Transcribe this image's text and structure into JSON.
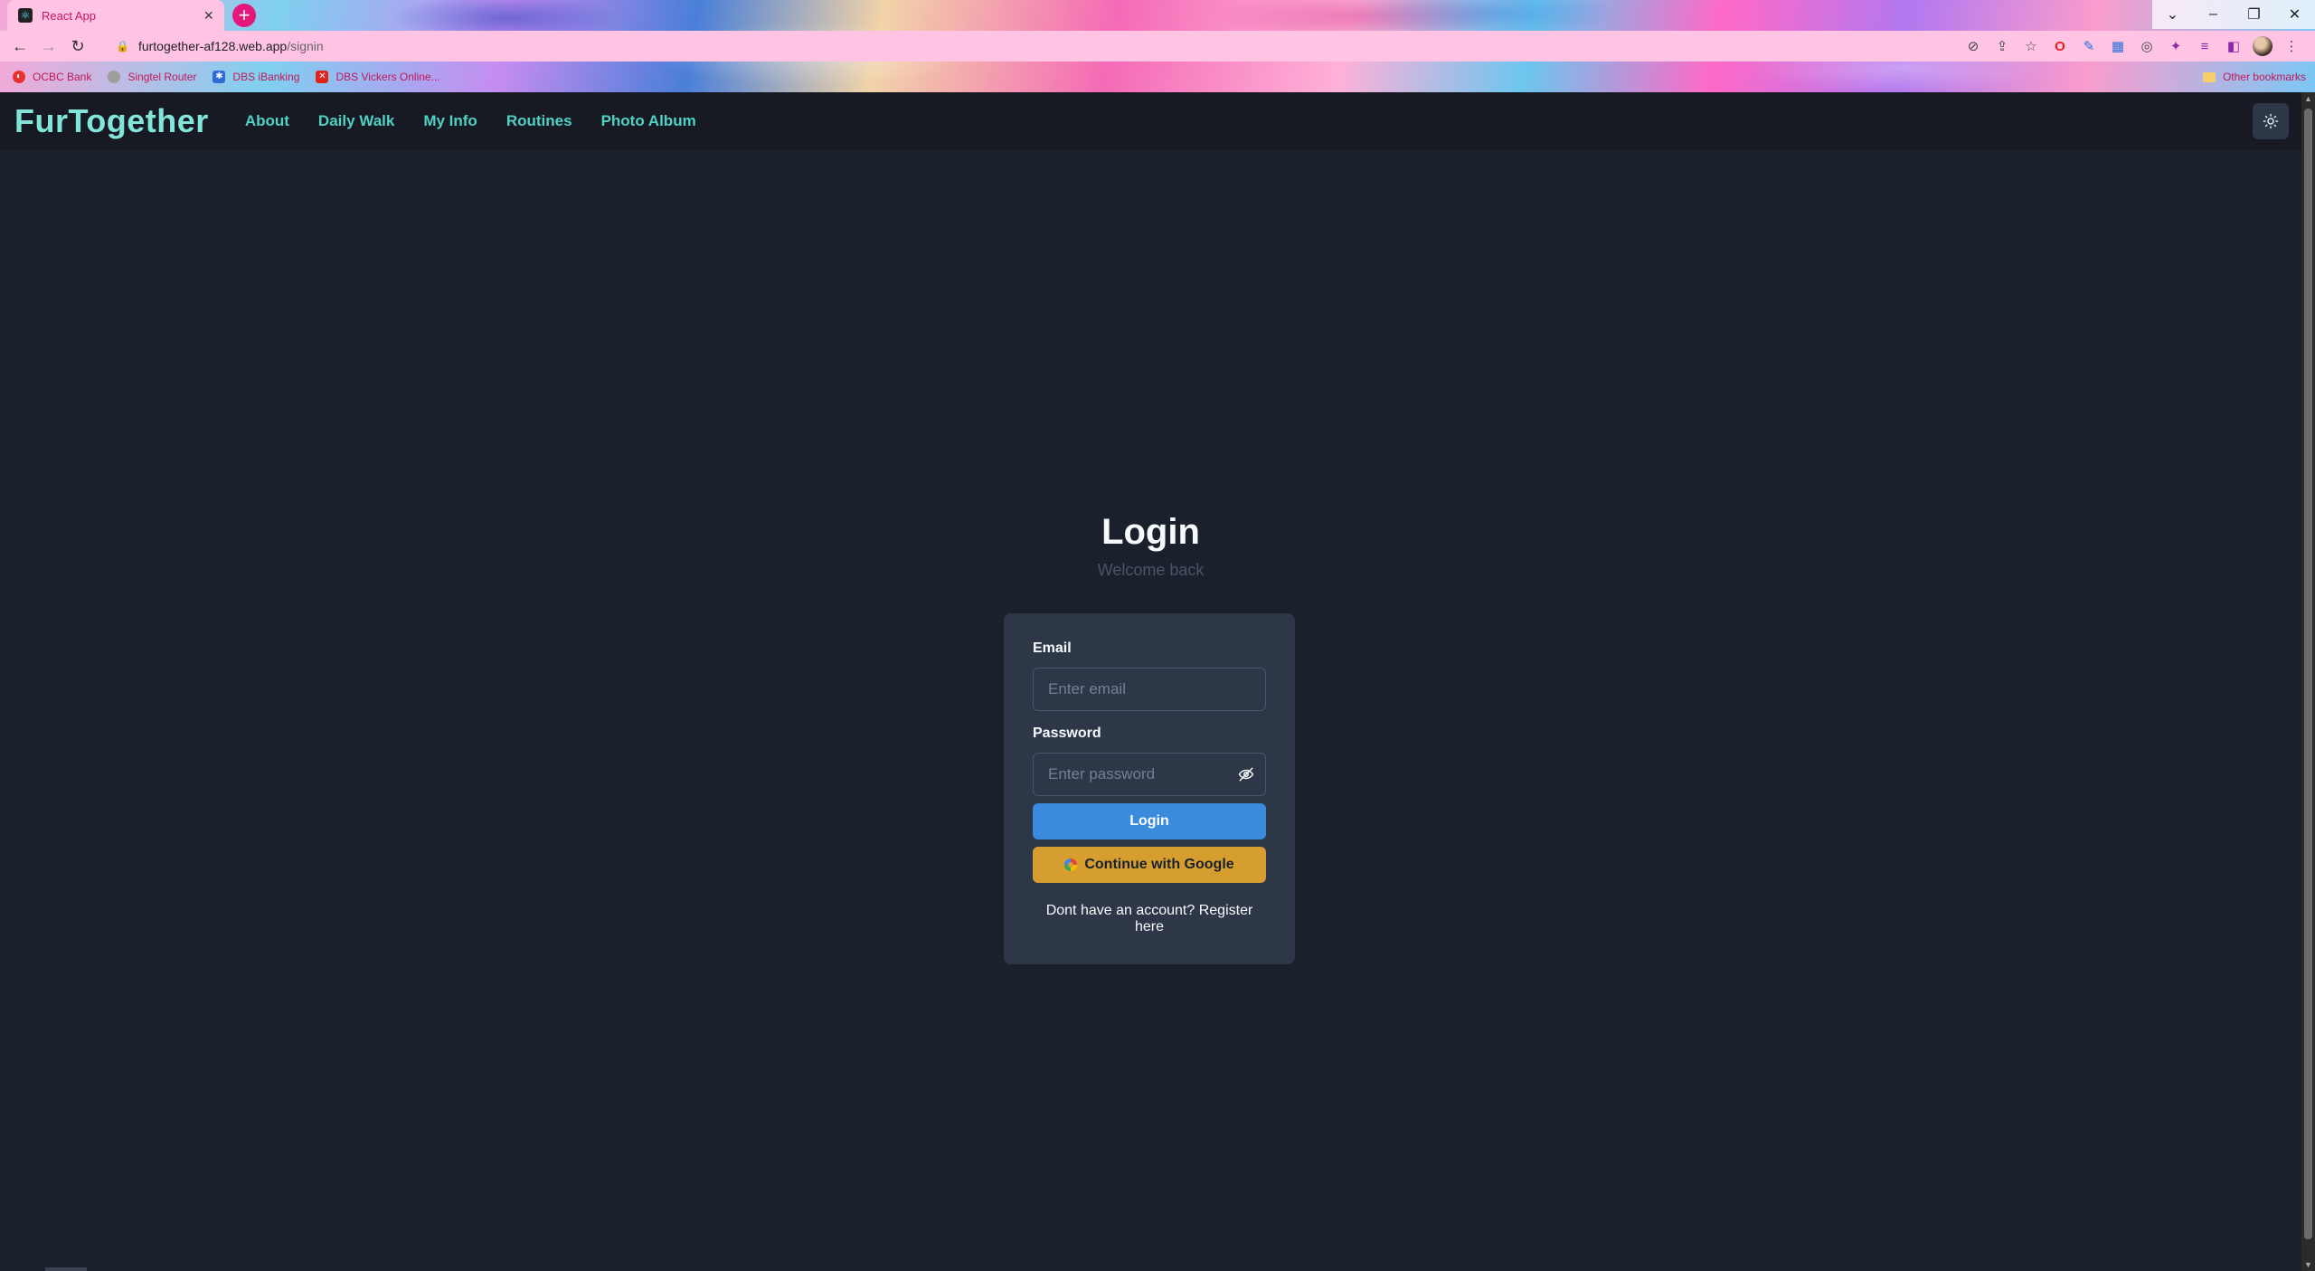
{
  "browser": {
    "tab_title": "React App",
    "new_tab_icon": "+",
    "url_domain": "furtogether-af128.web.app",
    "url_path": "/signin",
    "bookmarks": [
      {
        "label": "OCBC Bank",
        "color": "#e8312f"
      },
      {
        "label": "Singtel Router",
        "color": "#9e9e9e"
      },
      {
        "label": "DBS iBanking",
        "color": "#2f6ad8"
      },
      {
        "label": "DBS Vickers Online...",
        "color": "#e0241c"
      }
    ],
    "other_bookmarks": "Other bookmarks"
  },
  "nav": {
    "brand": "FurTogether",
    "links": [
      "About",
      "Daily Walk",
      "My Info",
      "Routines",
      "Photo Album"
    ],
    "theme_icon": "sun-icon"
  },
  "login": {
    "title": "Login",
    "subtitle": "Welcome back",
    "email_label": "Email",
    "email_placeholder": "Enter email",
    "password_label": "Password",
    "password_placeholder": "Enter password",
    "login_button": "Login",
    "google_button": "Continue with Google",
    "register_prompt": "Dont have an account?",
    "register_link": "Register here"
  },
  "colors": {
    "background": "#1a202c",
    "navbar": "#171923",
    "brand": "#81e6d9",
    "nav_link": "#4fd1c5",
    "card": "#2d3748",
    "login_button": "#3b8bdc",
    "google_button": "#d69e2e"
  }
}
